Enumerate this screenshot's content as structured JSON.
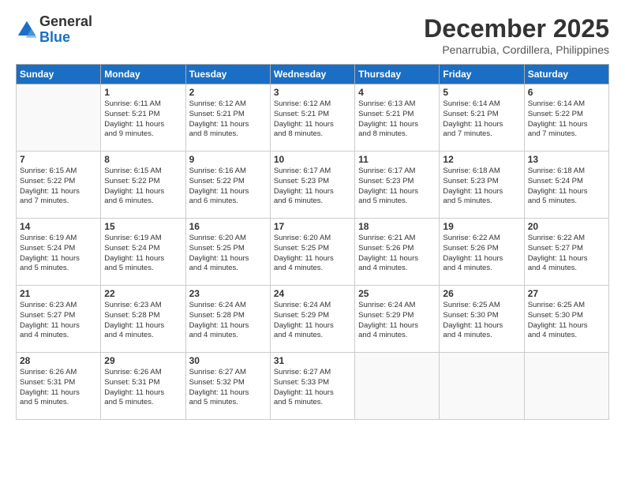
{
  "logo": {
    "general": "General",
    "blue": "Blue"
  },
  "title": "December 2025",
  "location": "Penarrubia, Cordillera, Philippines",
  "days": [
    "Sunday",
    "Monday",
    "Tuesday",
    "Wednesday",
    "Thursday",
    "Friday",
    "Saturday"
  ],
  "weeks": [
    [
      {
        "day": "",
        "sunrise": "",
        "sunset": "",
        "daylight": ""
      },
      {
        "day": "1",
        "sunrise": "Sunrise: 6:11 AM",
        "sunset": "Sunset: 5:21 PM",
        "daylight": "Daylight: 11 hours and 9 minutes."
      },
      {
        "day": "2",
        "sunrise": "Sunrise: 6:12 AM",
        "sunset": "Sunset: 5:21 PM",
        "daylight": "Daylight: 11 hours and 8 minutes."
      },
      {
        "day": "3",
        "sunrise": "Sunrise: 6:12 AM",
        "sunset": "Sunset: 5:21 PM",
        "daylight": "Daylight: 11 hours and 8 minutes."
      },
      {
        "day": "4",
        "sunrise": "Sunrise: 6:13 AM",
        "sunset": "Sunset: 5:21 PM",
        "daylight": "Daylight: 11 hours and 8 minutes."
      },
      {
        "day": "5",
        "sunrise": "Sunrise: 6:14 AM",
        "sunset": "Sunset: 5:21 PM",
        "daylight": "Daylight: 11 hours and 7 minutes."
      },
      {
        "day": "6",
        "sunrise": "Sunrise: 6:14 AM",
        "sunset": "Sunset: 5:22 PM",
        "daylight": "Daylight: 11 hours and 7 minutes."
      }
    ],
    [
      {
        "day": "7",
        "sunrise": "Sunrise: 6:15 AM",
        "sunset": "Sunset: 5:22 PM",
        "daylight": "Daylight: 11 hours and 7 minutes."
      },
      {
        "day": "8",
        "sunrise": "Sunrise: 6:15 AM",
        "sunset": "Sunset: 5:22 PM",
        "daylight": "Daylight: 11 hours and 6 minutes."
      },
      {
        "day": "9",
        "sunrise": "Sunrise: 6:16 AM",
        "sunset": "Sunset: 5:22 PM",
        "daylight": "Daylight: 11 hours and 6 minutes."
      },
      {
        "day": "10",
        "sunrise": "Sunrise: 6:17 AM",
        "sunset": "Sunset: 5:23 PM",
        "daylight": "Daylight: 11 hours and 6 minutes."
      },
      {
        "day": "11",
        "sunrise": "Sunrise: 6:17 AM",
        "sunset": "Sunset: 5:23 PM",
        "daylight": "Daylight: 11 hours and 5 minutes."
      },
      {
        "day": "12",
        "sunrise": "Sunrise: 6:18 AM",
        "sunset": "Sunset: 5:23 PM",
        "daylight": "Daylight: 11 hours and 5 minutes."
      },
      {
        "day": "13",
        "sunrise": "Sunrise: 6:18 AM",
        "sunset": "Sunset: 5:24 PM",
        "daylight": "Daylight: 11 hours and 5 minutes."
      }
    ],
    [
      {
        "day": "14",
        "sunrise": "Sunrise: 6:19 AM",
        "sunset": "Sunset: 5:24 PM",
        "daylight": "Daylight: 11 hours and 5 minutes."
      },
      {
        "day": "15",
        "sunrise": "Sunrise: 6:19 AM",
        "sunset": "Sunset: 5:24 PM",
        "daylight": "Daylight: 11 hours and 5 minutes."
      },
      {
        "day": "16",
        "sunrise": "Sunrise: 6:20 AM",
        "sunset": "Sunset: 5:25 PM",
        "daylight": "Daylight: 11 hours and 4 minutes."
      },
      {
        "day": "17",
        "sunrise": "Sunrise: 6:20 AM",
        "sunset": "Sunset: 5:25 PM",
        "daylight": "Daylight: 11 hours and 4 minutes."
      },
      {
        "day": "18",
        "sunrise": "Sunrise: 6:21 AM",
        "sunset": "Sunset: 5:26 PM",
        "daylight": "Daylight: 11 hours and 4 minutes."
      },
      {
        "day": "19",
        "sunrise": "Sunrise: 6:22 AM",
        "sunset": "Sunset: 5:26 PM",
        "daylight": "Daylight: 11 hours and 4 minutes."
      },
      {
        "day": "20",
        "sunrise": "Sunrise: 6:22 AM",
        "sunset": "Sunset: 5:27 PM",
        "daylight": "Daylight: 11 hours and 4 minutes."
      }
    ],
    [
      {
        "day": "21",
        "sunrise": "Sunrise: 6:23 AM",
        "sunset": "Sunset: 5:27 PM",
        "daylight": "Daylight: 11 hours and 4 minutes."
      },
      {
        "day": "22",
        "sunrise": "Sunrise: 6:23 AM",
        "sunset": "Sunset: 5:28 PM",
        "daylight": "Daylight: 11 hours and 4 minutes."
      },
      {
        "day": "23",
        "sunrise": "Sunrise: 6:24 AM",
        "sunset": "Sunset: 5:28 PM",
        "daylight": "Daylight: 11 hours and 4 minutes."
      },
      {
        "day": "24",
        "sunrise": "Sunrise: 6:24 AM",
        "sunset": "Sunset: 5:29 PM",
        "daylight": "Daylight: 11 hours and 4 minutes."
      },
      {
        "day": "25",
        "sunrise": "Sunrise: 6:24 AM",
        "sunset": "Sunset: 5:29 PM",
        "daylight": "Daylight: 11 hours and 4 minutes."
      },
      {
        "day": "26",
        "sunrise": "Sunrise: 6:25 AM",
        "sunset": "Sunset: 5:30 PM",
        "daylight": "Daylight: 11 hours and 4 minutes."
      },
      {
        "day": "27",
        "sunrise": "Sunrise: 6:25 AM",
        "sunset": "Sunset: 5:30 PM",
        "daylight": "Daylight: 11 hours and 4 minutes."
      }
    ],
    [
      {
        "day": "28",
        "sunrise": "Sunrise: 6:26 AM",
        "sunset": "Sunset: 5:31 PM",
        "daylight": "Daylight: 11 hours and 5 minutes."
      },
      {
        "day": "29",
        "sunrise": "Sunrise: 6:26 AM",
        "sunset": "Sunset: 5:31 PM",
        "daylight": "Daylight: 11 hours and 5 minutes."
      },
      {
        "day": "30",
        "sunrise": "Sunrise: 6:27 AM",
        "sunset": "Sunset: 5:32 PM",
        "daylight": "Daylight: 11 hours and 5 minutes."
      },
      {
        "day": "31",
        "sunrise": "Sunrise: 6:27 AM",
        "sunset": "Sunset: 5:33 PM",
        "daylight": "Daylight: 11 hours and 5 minutes."
      },
      {
        "day": "",
        "sunrise": "",
        "sunset": "",
        "daylight": ""
      },
      {
        "day": "",
        "sunrise": "",
        "sunset": "",
        "daylight": ""
      },
      {
        "day": "",
        "sunrise": "",
        "sunset": "",
        "daylight": ""
      }
    ]
  ]
}
